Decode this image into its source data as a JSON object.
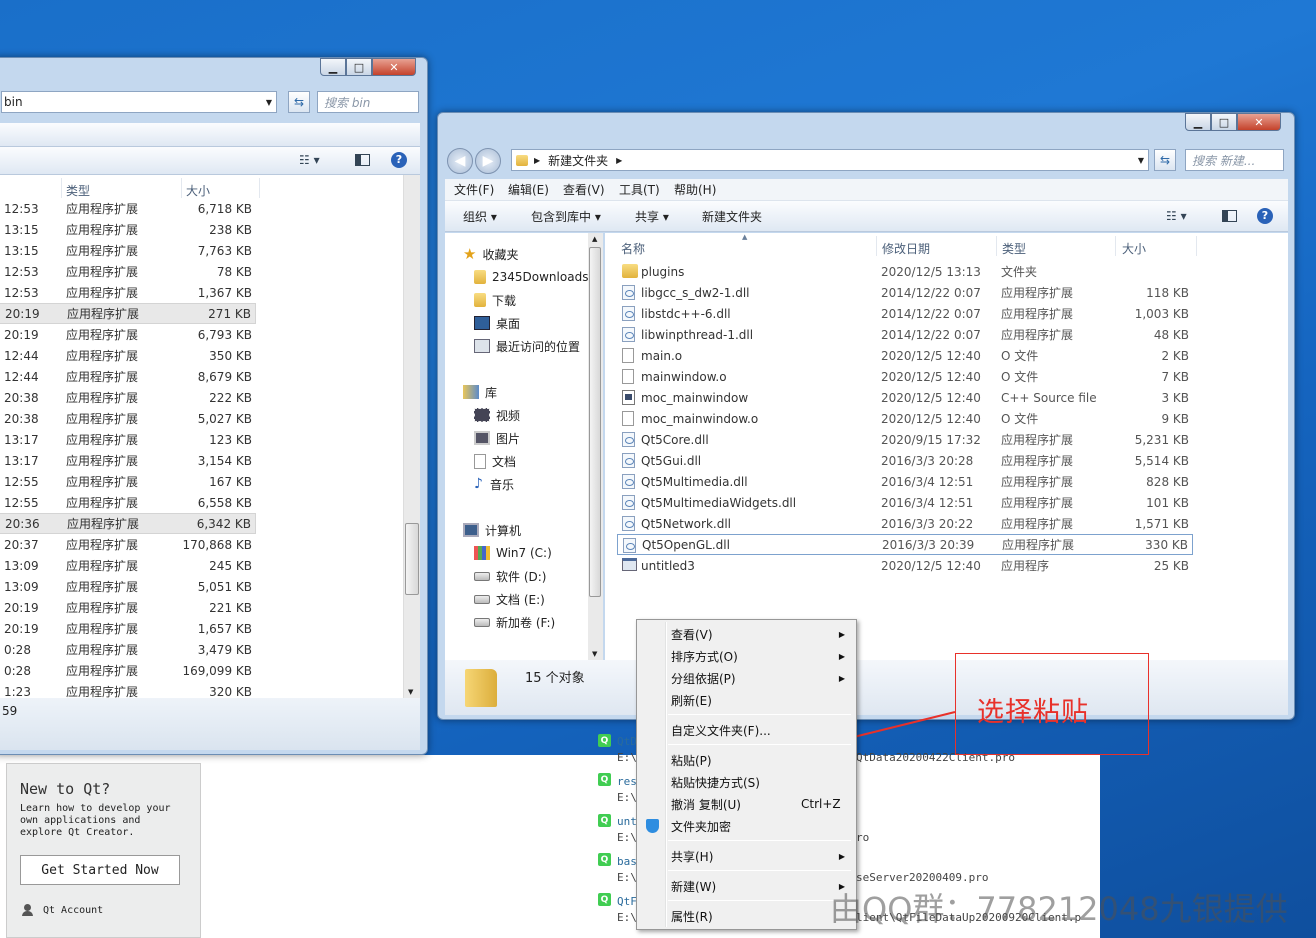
{
  "left_window": {
    "address": "bin",
    "search_placeholder": "搜索 bin",
    "col_type": "类型",
    "col_size": "大小",
    "status": "59",
    "rows": [
      {
        "time": "12:53",
        "type": "应用程序扩展",
        "size": "6,718 KB"
      },
      {
        "time": "13:15",
        "type": "应用程序扩展",
        "size": "238 KB"
      },
      {
        "time": "13:15",
        "type": "应用程序扩展",
        "size": "7,763 KB"
      },
      {
        "time": "12:53",
        "type": "应用程序扩展",
        "size": "78 KB"
      },
      {
        "time": "12:53",
        "type": "应用程序扩展",
        "size": "1,367 KB"
      },
      {
        "time": "20:19",
        "type": "应用程序扩展",
        "size": "271 KB"
      },
      {
        "time": "20:19",
        "type": "应用程序扩展",
        "size": "6,793 KB"
      },
      {
        "time": "12:44",
        "type": "应用程序扩展",
        "size": "350 KB"
      },
      {
        "time": "12:44",
        "type": "应用程序扩展",
        "size": "8,679 KB"
      },
      {
        "time": "20:38",
        "type": "应用程序扩展",
        "size": "222 KB"
      },
      {
        "time": "20:38",
        "type": "应用程序扩展",
        "size": "5,027 KB"
      },
      {
        "time": "13:17",
        "type": "应用程序扩展",
        "size": "123 KB"
      },
      {
        "time": "13:17",
        "type": "应用程序扩展",
        "size": "3,154 KB"
      },
      {
        "time": "12:55",
        "type": "应用程序扩展",
        "size": "167 KB"
      },
      {
        "time": "12:55",
        "type": "应用程序扩展",
        "size": "6,558 KB"
      },
      {
        "time": "20:36",
        "type": "应用程序扩展",
        "size": "6,342 KB"
      },
      {
        "time": "20:37",
        "type": "应用程序扩展",
        "size": "170,868 KB"
      },
      {
        "time": "13:09",
        "type": "应用程序扩展",
        "size": "245 KB"
      },
      {
        "time": "13:09",
        "type": "应用程序扩展",
        "size": "5,051 KB"
      },
      {
        "time": "20:19",
        "type": "应用程序扩展",
        "size": "221 KB"
      },
      {
        "time": "20:19",
        "type": "应用程序扩展",
        "size": "1,657 KB"
      },
      {
        "time": "0:28",
        "type": "应用程序扩展",
        "size": "3,479 KB"
      },
      {
        "time": "0:28",
        "type": "应用程序扩展",
        "size": "169,099 KB"
      },
      {
        "time": "1:23",
        "type": "应用程序扩展",
        "size": "320 KB"
      }
    ]
  },
  "right_window": {
    "address": "新建文件夹",
    "search_placeholder": "搜索 新建...",
    "menubar": [
      "文件(F)",
      "编辑(E)",
      "查看(V)",
      "工具(T)",
      "帮助(H)"
    ],
    "toolbar": {
      "organize": "组织",
      "include": "包含到库中",
      "share": "共享",
      "new_folder": "新建文件夹"
    },
    "columns": {
      "name": "名称",
      "date": "修改日期",
      "type": "类型",
      "size": "大小"
    },
    "nav": {
      "favorites": "收藏夹",
      "fav_items": [
        "2345Downloads",
        "下载",
        "桌面",
        "最近访问的位置"
      ],
      "libraries": "库",
      "lib_items": [
        "视频",
        "图片",
        "文档",
        "音乐"
      ],
      "computer": "计算机",
      "drives": [
        "Win7 (C:)",
        "软件 (D:)",
        "文档 (E:)",
        "新加卷 (F:)"
      ]
    },
    "files": [
      {
        "icon": "folder",
        "name": "plugins",
        "date": "2020/12/5 13:13",
        "type": "文件夹",
        "size": ""
      },
      {
        "icon": "dll",
        "name": "libgcc_s_dw2-1.dll",
        "date": "2014/12/22 0:07",
        "type": "应用程序扩展",
        "size": "118 KB"
      },
      {
        "icon": "dll",
        "name": "libstdc++-6.dll",
        "date": "2014/12/22 0:07",
        "type": "应用程序扩展",
        "size": "1,003 KB"
      },
      {
        "icon": "dll",
        "name": "libwinpthread-1.dll",
        "date": "2014/12/22 0:07",
        "type": "应用程序扩展",
        "size": "48 KB"
      },
      {
        "icon": "doc",
        "name": "main.o",
        "date": "2020/12/5 12:40",
        "type": "O 文件",
        "size": "2 KB"
      },
      {
        "icon": "doc",
        "name": "mainwindow.o",
        "date": "2020/12/5 12:40",
        "type": "O 文件",
        "size": "7 KB"
      },
      {
        "icon": "cpp",
        "name": "moc_mainwindow",
        "date": "2020/12/5 12:40",
        "type": "C++ Source file",
        "size": "3 KB"
      },
      {
        "icon": "doc",
        "name": "moc_mainwindow.o",
        "date": "2020/12/5 12:40",
        "type": "O 文件",
        "size": "9 KB"
      },
      {
        "icon": "dll",
        "name": "Qt5Core.dll",
        "date": "2020/9/15 17:32",
        "type": "应用程序扩展",
        "size": "5,231 KB"
      },
      {
        "icon": "dll",
        "name": "Qt5Gui.dll",
        "date": "2016/3/3 20:28",
        "type": "应用程序扩展",
        "size": "5,514 KB"
      },
      {
        "icon": "dll",
        "name": "Qt5Multimedia.dll",
        "date": "2016/3/4 12:51",
        "type": "应用程序扩展",
        "size": "828 KB"
      },
      {
        "icon": "dll",
        "name": "Qt5MultimediaWidgets.dll",
        "date": "2016/3/4 12:51",
        "type": "应用程序扩展",
        "size": "101 KB"
      },
      {
        "icon": "dll",
        "name": "Qt5Network.dll",
        "date": "2016/3/3 20:22",
        "type": "应用程序扩展",
        "size": "1,571 KB"
      },
      {
        "icon": "dll",
        "name": "Qt5OpenGL.dll",
        "date": "2016/3/3 20:39",
        "type": "应用程序扩展",
        "size": "330 KB"
      },
      {
        "icon": "exe",
        "name": "untitled3",
        "date": "2020/12/5 12:40",
        "type": "应用程序",
        "size": "25 KB"
      }
    ],
    "status": "15 个对象"
  },
  "context_menu": [
    {
      "label": "查看(V)",
      "submenu": true
    },
    {
      "label": "排序方式(O)",
      "submenu": true
    },
    {
      "label": "分组依据(P)",
      "submenu": true
    },
    {
      "label": "刷新(E)"
    },
    {
      "label": "自定义文件夹(F)..."
    },
    {
      "label": "粘贴(P)"
    },
    {
      "label": "粘贴快捷方式(S)"
    },
    {
      "label": "撤消 复制(U)",
      "shortcut": "Ctrl+Z"
    },
    {
      "label": "文件夹加密"
    },
    {
      "label": "共享(H)",
      "submenu": true
    },
    {
      "label": "新建(W)",
      "submenu": true
    },
    {
      "label": "属性(R)"
    }
  ],
  "annotation": {
    "text": "选择粘贴",
    "color": "#e8312a"
  },
  "qt_creator": {
    "new_title": "New to Qt?",
    "new_desc": [
      "Learn how to develop your",
      "own applications and",
      "explore Qt Creator."
    ],
    "get_started": "Get Started Now",
    "account": "Qt Account",
    "projects": [
      {
        "name": "QtD",
        "path": "E:\\",
        "tail": "QtData20200422Client.pro"
      },
      {
        "name": "res",
        "path": "E:\\",
        "tail": ""
      },
      {
        "name": "unt",
        "path": "E:\\",
        "tail": "ro"
      },
      {
        "name": "bas",
        "path": "E:\\",
        "tail": "seServer20200409.pro"
      },
      {
        "name": "QtF",
        "path": "E:\\",
        "tail": "lient\\QtFileDataUp20200920Client.p"
      }
    ]
  },
  "watermark": "由QQ群：778212048九银提供"
}
